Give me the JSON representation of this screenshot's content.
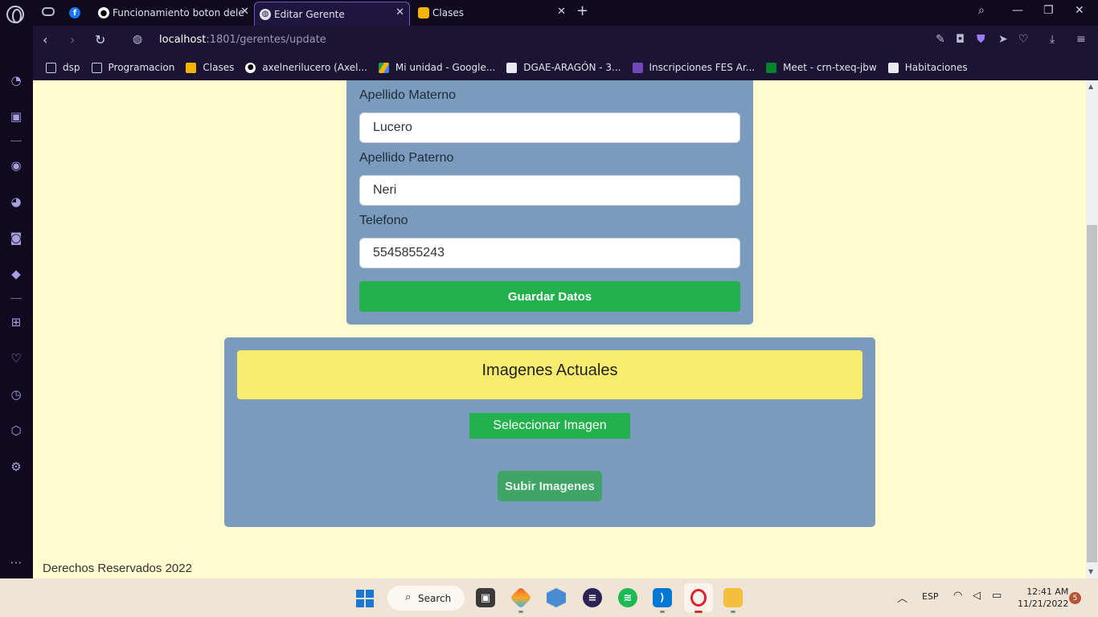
{
  "browser": {
    "tabs": [
      {
        "label": "Funcionamiento boton dele",
        "favicon": "github-icon"
      },
      {
        "label": "Editar Gerente",
        "favicon": "globe-icon",
        "active": true
      },
      {
        "label": "Clases",
        "favicon": "classroom-icon"
      }
    ],
    "url_host": "localhost",
    "url_path": ":1801/gerentes/update"
  },
  "bookmarks": [
    {
      "label": "dsp",
      "icon": "folder-icon"
    },
    {
      "label": "Programacion",
      "icon": "folder-icon"
    },
    {
      "label": "Clases",
      "icon": "classroom-icon"
    },
    {
      "label": "axelnerilucero (Axel...",
      "icon": "github-icon"
    },
    {
      "label": "Mi unidad - Google...",
      "icon": "drive-icon"
    },
    {
      "label": "DGAE-ARAGÓN - 3...",
      "icon": "document-icon"
    },
    {
      "label": "Inscripciones FES Ar...",
      "icon": "forms-icon"
    },
    {
      "label": "Meet - crn-txeq-jbw",
      "icon": "meet-icon"
    },
    {
      "label": "Habitaciones",
      "icon": "document-icon"
    }
  ],
  "form": {
    "apellido_materno_label": "Apellido Materno",
    "apellido_materno_value": "Lucero",
    "apellido_paterno_label": "Apellido Paterno",
    "apellido_paterno_value": "Neri",
    "telefono_label": "Telefono",
    "telefono_value": "5545855243",
    "save_label": "Guardar Datos"
  },
  "images": {
    "header": "Imagenes Actuales",
    "select_label": "Seleccionar Imagen",
    "upload_label": "Subir Imagenes"
  },
  "footer": {
    "text": "Derechos Reservados 2022"
  },
  "taskbar": {
    "search_label": "Search",
    "language": "ESP",
    "time": "12:41 AM",
    "date": "11/21/2022",
    "notifications": "5"
  },
  "colors": {
    "page_bg": "#fffdd0",
    "card_bg": "#7b9bbd",
    "green": "#22b14c",
    "header_yellow": "#f7ec6e"
  }
}
